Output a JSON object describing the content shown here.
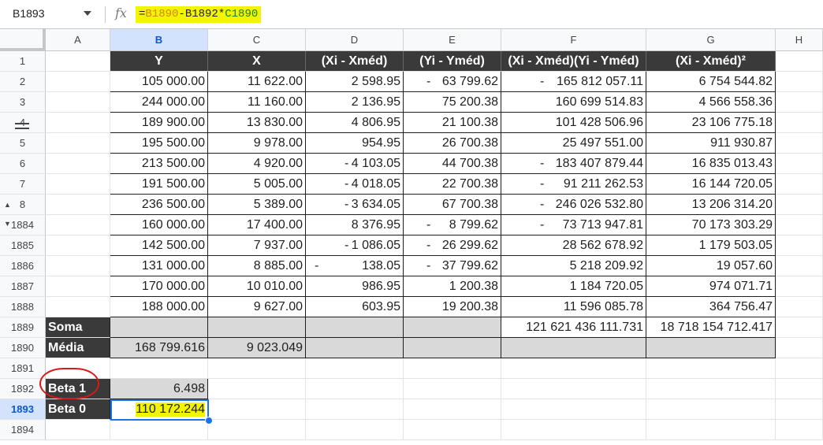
{
  "formula_bar": {
    "name_box": "B1893",
    "fx_label": "fx",
    "formula_eq": "=",
    "formula_ref1": "B1890",
    "formula_op1": "-",
    "formula_ref2": "B1892",
    "formula_op2": "*",
    "formula_ref3": "C1890"
  },
  "columns": [
    "A",
    "B",
    "C",
    "D",
    "E",
    "F",
    "G",
    "H"
  ],
  "row_numbers": [
    "1",
    "2",
    "3",
    "4",
    "5",
    "6",
    "7",
    "8",
    "1884",
    "1885",
    "1886",
    "1887",
    "1888",
    "1889",
    "1890",
    "1891",
    "1892",
    "1893",
    "1894"
  ],
  "headers": [
    "Y",
    "X",
    "(Xi - Xméd)",
    "(Yi - Yméd)",
    "(Xi - Xméd)(Yi - Yméd)",
    "(Xi - Xméd)²"
  ],
  "rows": [
    {
      "y": "105 000.00",
      "x": "11 622.00",
      "d": "2 598.95",
      "e": "63 799.62",
      "e_neg": true,
      "f": "165 812 057.11",
      "f_neg": true,
      "g": "6 754 544.82"
    },
    {
      "y": "244 000.00",
      "x": "11 160.00",
      "d": "2 136.95",
      "e": "75 200.38",
      "f": "160 699 514.83",
      "g": "4 566 558.36"
    },
    {
      "y": "189 900.00",
      "x": "13 830.00",
      "d": "4 806.95",
      "e": "21 100.38",
      "f": "101 428 506.96",
      "g": "23 106 775.18"
    },
    {
      "y": "195 500.00",
      "x": "9 978.00",
      "d": "954.95",
      "e": "26 700.38",
      "f": "25 497 551.00",
      "g": "911 930.87"
    },
    {
      "y": "213 500.00",
      "x": "4 920.00",
      "d": "4 103.05",
      "d_neg": true,
      "e": "44 700.38",
      "f": "183 407 879.44",
      "f_neg": true,
      "g": "16 835 013.43"
    },
    {
      "y": "191 500.00",
      "x": "5 005.00",
      "d": "4 018.05",
      "d_neg": true,
      "e": "22 700.38",
      "f": "91 211 262.53",
      "f_neg": true,
      "g": "16 144 720.05"
    },
    {
      "y": "236 500.00",
      "x": "5 389.00",
      "d": "3 634.05",
      "d_neg": true,
      "e": "67 700.38",
      "f": "246 026 532.80",
      "f_neg": true,
      "g": "13 206 314.20"
    },
    {
      "y": "160 000.00",
      "x": "17 400.00",
      "d": "8 376.95",
      "e": "8 799.62",
      "e_neg": true,
      "f": "73 713 947.81",
      "f_neg": true,
      "g": "70 173 303.29"
    },
    {
      "y": "142 500.00",
      "x": "7 937.00",
      "d": "1 086.05",
      "d_neg": true,
      "e": "26 299.62",
      "e_neg": true,
      "f": "28 562 678.92",
      "g": "1 179 503.05"
    },
    {
      "y": "131 000.00",
      "x": "8 885.00",
      "d": "138.05",
      "d_neg": true,
      "e": "37 799.62",
      "e_neg": true,
      "f": "5 218 209.92",
      "g": "19 057.60"
    },
    {
      "y": "170 000.00",
      "x": "10 010.00",
      "d": "986.95",
      "e": "1 200.38",
      "f": "1 184 720.05",
      "g": "974 071.71"
    },
    {
      "y": "188 000.00",
      "x": "9 627.00",
      "d": "603.95",
      "e": "19 200.38",
      "f": "11 596 085.78",
      "g": "364 756.47"
    }
  ],
  "neg_sign": "-",
  "soma": {
    "label": "Soma",
    "f": "121 621 436 111.731",
    "g": "18 718 154 712.417"
  },
  "media": {
    "label": "Média",
    "y": "168 799.616",
    "x": "9 023.049"
  },
  "beta1": {
    "label": "Beta 1",
    "value": "6.498"
  },
  "beta0": {
    "label": "Beta 0",
    "value": "110 172.244"
  },
  "colors": {
    "highlight": "#f3f500",
    "header_bg": "#3a3a3a",
    "gray_fill": "#d9d9d9",
    "selection": "#1a73e8",
    "annotation": "#d61a1a"
  }
}
